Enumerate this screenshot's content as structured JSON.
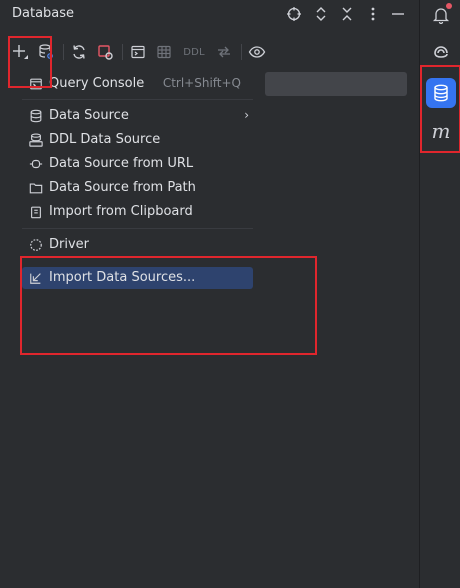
{
  "window": {
    "title": "Database"
  },
  "toolbar": {
    "ddl_label": "DDL"
  },
  "menu": {
    "query_console": {
      "label": "Query Console",
      "shortcut": "Ctrl+Shift+Q"
    },
    "items": [
      {
        "label": "Data Source"
      },
      {
        "label": "DDL Data Source"
      },
      {
        "label": "Data Source from URL"
      },
      {
        "label": "Data Source from Path"
      },
      {
        "label": "Import from Clipboard"
      },
      {
        "label": "Driver"
      },
      {
        "label": "Import Data Sources..."
      }
    ],
    "submenu_arrow": "›"
  },
  "rightbar": {
    "markdown_glyph": "m"
  },
  "icons": {
    "header": [
      "crosshair-icon",
      "expand-collapse-icon",
      "collapse-all-icon",
      "more-vertical-icon",
      "minimize-icon"
    ],
    "toolbar": [
      "add-icon",
      "database-settings-icon",
      "refresh-icon",
      "stop-icon",
      "query-console-icon",
      "table-icon",
      "ddl-icon",
      "jump-icon",
      "view-icon"
    ],
    "rightbar": [
      "notifications-icon",
      "ai-assistant-icon",
      "database-icon",
      "markdown-icon"
    ]
  },
  "colors": {
    "background": "#2b2d30",
    "selection": "#2e436e",
    "accent": "#3574f0",
    "highlight_box": "#e0262d",
    "notification_dot": "#e55765"
  }
}
